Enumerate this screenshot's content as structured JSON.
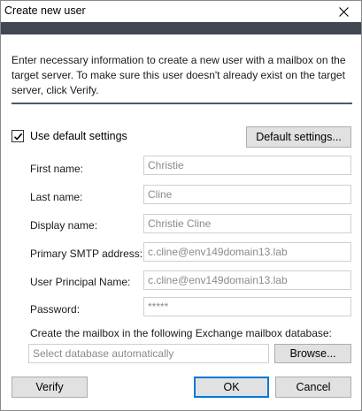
{
  "window": {
    "title": "Create new user"
  },
  "intro_text": "Enter necessary information to create a new user with a mailbox on the target server. To make sure this user doesn't already exist on the target server, click Verify.",
  "use_default": {
    "label": "Use default settings",
    "checked": true
  },
  "buttons": {
    "default_settings": "Default settings...",
    "browse": "Browse...",
    "verify": "Verify",
    "ok": "OK",
    "cancel": "Cancel"
  },
  "fields": [
    {
      "label": "First name:",
      "value": "Christie"
    },
    {
      "label": "Last name:",
      "value": "Cline"
    },
    {
      "label": "Display name:",
      "value": "Christie Cline"
    },
    {
      "label": "Primary SMTP address:",
      "value": "c.cline@env149domain13.lab"
    },
    {
      "label": "User Principal Name:",
      "value": "c.cline@env149domain13.lab"
    },
    {
      "label": "Password:",
      "value": "*****"
    }
  ],
  "database": {
    "label": "Create the mailbox in the following Exchange mailbox database:",
    "placeholder": "Select database automatically"
  },
  "colors": {
    "header_band": "#3f4752",
    "accent": "#0078d7"
  }
}
